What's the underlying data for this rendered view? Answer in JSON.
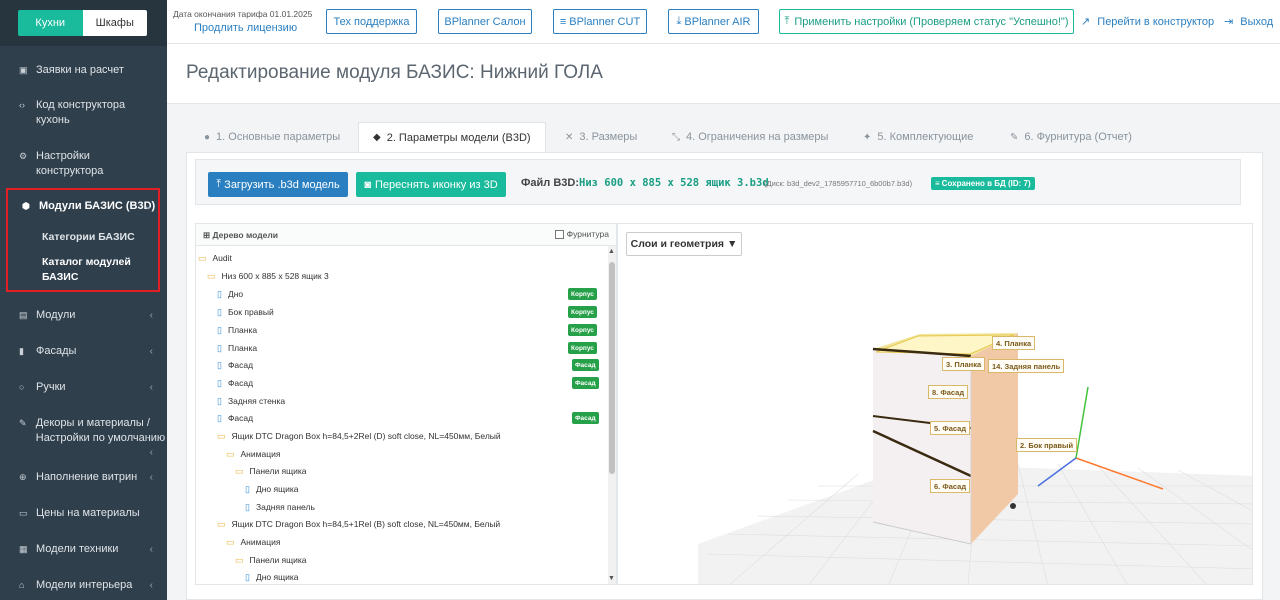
{
  "sidebar": {
    "switch": {
      "active": "Кухни",
      "inactive": "Шкафы"
    },
    "items": [
      {
        "label": "Заявки на расчет",
        "icon": "clipboard-icon"
      },
      {
        "label": "Код конструктора кухонь",
        "icon": "code-icon"
      },
      {
        "label": "Настройки конструктора",
        "icon": "gears-icon"
      },
      {
        "label": "Модули БАЗИС (B3D)",
        "icon": "cubes-icon"
      },
      {
        "label": "Модули",
        "icon": "table-icon"
      },
      {
        "label": "Фасады",
        "icon": "book-icon"
      },
      {
        "label": "Ручки",
        "icon": "circle-icon"
      },
      {
        "label": "Декоры и материалы / Настройки по умолчанию",
        "icon": "wrench-icon"
      },
      {
        "label": "Наполнение витрин",
        "icon": "cart-icon"
      },
      {
        "label": "Цены на материалы",
        "icon": "money-icon"
      },
      {
        "label": "Модели техники",
        "icon": "list-icon"
      },
      {
        "label": "Модели интерьера",
        "icon": "sofa-icon"
      }
    ],
    "subitems": [
      "Категории БАЗИС",
      "Каталог модулей БАЗИС"
    ]
  },
  "topbar": {
    "date": "Дата окончания тарифа 01.01.2025",
    "license": "Продлить лицензию",
    "buttons": [
      "Тех поддержка",
      "BPlanner Салон",
      "BPlanner CUT",
      "BPlanner AIR",
      "Применить настройки (Проверяем статус \"Успешно!\")"
    ],
    "constructor_link": "Перейти в конструктор",
    "exit_link": "Выход"
  },
  "page": {
    "title": "Редактирование модуля БАЗИС: Нижний ГОЛА"
  },
  "tabs": [
    "1. Основные параметры",
    "2. Параметры модели (B3D)",
    "3. Размеры",
    "4. Ограничения на размеры",
    "5. Комплектующие",
    "6. Фурнитура (Отчет)"
  ],
  "toolbar": {
    "upload": "Загрузить .b3d модель",
    "reshoot": "Переснять иконку из 3D",
    "file_label": "Файл B3D:",
    "file_name": "Низ 600 x 885 x 528 ящик 3.b3d",
    "disk": "(Диск: b3d_dev2_1785957710_6b00b7.b3d)",
    "saved": "Сохранено в БД (ID: 7)"
  },
  "tree": {
    "title": "Дерево модели",
    "furniture_label": "Фурнитура",
    "nodes": [
      {
        "label": "Audit",
        "type": "folder"
      },
      {
        "label": "Низ 600 x 885 x 528 ящик 3",
        "type": "folder"
      },
      {
        "label": "Дно",
        "type": "file",
        "badge": "Корпус"
      },
      {
        "label": "Бок правый",
        "type": "file",
        "badge": "Корпус"
      },
      {
        "label": "Планка",
        "type": "file",
        "badge": "Корпус"
      },
      {
        "label": "Планка",
        "type": "file",
        "badge": "Корпус"
      },
      {
        "label": "Фасад",
        "type": "file",
        "badge": "Фасад"
      },
      {
        "label": "Фасад",
        "type": "file",
        "badge": "Фасад"
      },
      {
        "label": "Задняя стенка",
        "type": "file",
        "badge": ""
      },
      {
        "label": "Фасад",
        "type": "file",
        "badge": "Фасад"
      },
      {
        "label": "Ящик DTC Dragon Box h=84,5+2Rel (D) soft close, NL=450мм, Белый",
        "type": "folder"
      },
      {
        "label": "Анимация",
        "type": "folder"
      },
      {
        "label": "Панели ящика",
        "type": "folder"
      },
      {
        "label": "Дно ящика",
        "type": "file"
      },
      {
        "label": "Задняя панель",
        "type": "file"
      },
      {
        "label": "Ящик DTC Dragon Box h=84,5+1Rel (B) soft close, NL=450мм, Белый",
        "type": "folder"
      },
      {
        "label": "Анимация",
        "type": "folder"
      },
      {
        "label": "Панели ящика",
        "type": "folder"
      },
      {
        "label": "Дно ящика",
        "type": "file"
      }
    ]
  },
  "viewer": {
    "layers_button": "Слои и геометрия ▼",
    "labels": [
      "4. Планка",
      "3. Планка",
      "14. Задняя панель",
      "8. Фасад",
      "5. Фасад",
      "2. Бок правый",
      "6. Фасад"
    ]
  },
  "colors": {
    "sidebar": "#2f3f4c",
    "accent_green": "#1abb9c",
    "accent_blue": "#2a7fc1",
    "highlight_red": "#e31e24"
  }
}
